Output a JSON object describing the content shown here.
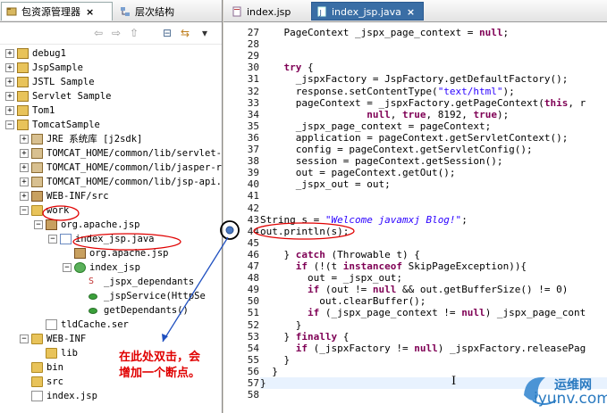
{
  "left_tabs": [
    {
      "label": "包资源管理器",
      "close": "×"
    },
    {
      "label": "层次结构"
    }
  ],
  "editor_tabs": [
    {
      "label": "index.jsp"
    },
    {
      "label": "index_jsp.java",
      "close": "×"
    }
  ],
  "tree": [
    {
      "label": "debug1"
    },
    {
      "label": "JspSample"
    },
    {
      "label": "JSTL Sample"
    },
    {
      "label": "Servlet Sample"
    },
    {
      "label": "Tom1"
    },
    {
      "label": "TomcatSample"
    },
    {
      "label": "JRE 系统库 [j2sdk]"
    },
    {
      "label": "TOMCAT_HOME/common/lib/servlet-"
    },
    {
      "label": "TOMCAT_HOME/common/lib/jasper-r"
    },
    {
      "label": "TOMCAT_HOME/common/lib/jsp-api."
    },
    {
      "label": "WEB-INF/src"
    },
    {
      "label": "work"
    },
    {
      "label": "org.apache.jsp"
    },
    {
      "label": "index_jsp.java"
    },
    {
      "label": "org.apache.jsp"
    },
    {
      "label": "index_jsp"
    },
    {
      "label": "_jspx_dependants"
    },
    {
      "label": "_jspService(HttpSe"
    },
    {
      "label": "getDependants()"
    },
    {
      "label": "tldCache.ser"
    },
    {
      "label": "WEB-INF"
    },
    {
      "label": "lib"
    },
    {
      "label": "bin"
    },
    {
      "label": "src"
    },
    {
      "label": "index.jsp"
    }
  ],
  "code_lines": [
    {
      "n": "27",
      "segs": [
        {
          "t": "    PageContext _jspx_page_context = "
        },
        {
          "t": "null",
          "c": "kw"
        },
        {
          "t": ";"
        }
      ]
    },
    {
      "n": "28",
      "segs": [
        {
          "t": ""
        }
      ]
    },
    {
      "n": "29",
      "segs": [
        {
          "t": ""
        }
      ]
    },
    {
      "n": "30",
      "segs": [
        {
          "t": "    "
        },
        {
          "t": "try",
          "c": "kw"
        },
        {
          "t": " {"
        }
      ]
    },
    {
      "n": "31",
      "segs": [
        {
          "t": "      _jspxFactory = JspFactory.getDefaultFactory();"
        }
      ]
    },
    {
      "n": "32",
      "segs": [
        {
          "t": "      response.setContentType("
        },
        {
          "t": "\"text/html\"",
          "c": "str"
        },
        {
          "t": ");"
        }
      ]
    },
    {
      "n": "33",
      "segs": [
        {
          "t": "      pageContext = _jspxFactory.getPageContext("
        },
        {
          "t": "this",
          "c": "kw"
        },
        {
          "t": ", r"
        }
      ]
    },
    {
      "n": "34",
      "segs": [
        {
          "t": "                  "
        },
        {
          "t": "null",
          "c": "kw"
        },
        {
          "t": ", "
        },
        {
          "t": "true",
          "c": "kw"
        },
        {
          "t": ", 8192, "
        },
        {
          "t": "true",
          "c": "kw"
        },
        {
          "t": ");"
        }
      ]
    },
    {
      "n": "35",
      "segs": [
        {
          "t": "      _jspx_page_context = pageContext;"
        }
      ]
    },
    {
      "n": "36",
      "segs": [
        {
          "t": "      application = pageContext.getServletContext();"
        }
      ]
    },
    {
      "n": "37",
      "segs": [
        {
          "t": "      config = pageContext.getServletConfig();"
        }
      ]
    },
    {
      "n": "38",
      "segs": [
        {
          "t": "      session = pageContext.getSession();"
        }
      ]
    },
    {
      "n": "39",
      "segs": [
        {
          "t": "      out = pageContext.getOut();"
        }
      ]
    },
    {
      "n": "40",
      "segs": [
        {
          "t": "      _jspx_out = out;"
        }
      ]
    },
    {
      "n": "41",
      "segs": [
        {
          "t": ""
        }
      ]
    },
    {
      "n": "42",
      "segs": [
        {
          "t": ""
        }
      ]
    },
    {
      "n": "43",
      "segs": [
        {
          "t": "String s = "
        },
        {
          "t": "\"Welcome javamxj Blog!\"",
          "c": "ital"
        },
        {
          "t": ";"
        }
      ]
    },
    {
      "n": "44",
      "segs": [
        {
          "t": "out.println(s);"
        }
      ]
    },
    {
      "n": "45",
      "segs": [
        {
          "t": ""
        }
      ]
    },
    {
      "n": "46",
      "segs": [
        {
          "t": "    } "
        },
        {
          "t": "catch",
          "c": "kw"
        },
        {
          "t": " (Throwable t) {"
        }
      ]
    },
    {
      "n": "47",
      "segs": [
        {
          "t": "      "
        },
        {
          "t": "if",
          "c": "kw"
        },
        {
          "t": " (!(t "
        },
        {
          "t": "instanceof",
          "c": "kw"
        },
        {
          "t": " SkipPageException)){"
        }
      ]
    },
    {
      "n": "48",
      "segs": [
        {
          "t": "        out = _jspx_out;"
        }
      ]
    },
    {
      "n": "49",
      "segs": [
        {
          "t": "        "
        },
        {
          "t": "if",
          "c": "kw"
        },
        {
          "t": " (out != "
        },
        {
          "t": "null",
          "c": "kw"
        },
        {
          "t": " && out.getBufferSize() != 0)"
        }
      ]
    },
    {
      "n": "50",
      "segs": [
        {
          "t": "          out.clearBuffer();"
        }
      ]
    },
    {
      "n": "51",
      "segs": [
        {
          "t": "        "
        },
        {
          "t": "if",
          "c": "kw"
        },
        {
          "t": " (_jspx_page_context != "
        },
        {
          "t": "null",
          "c": "kw"
        },
        {
          "t": ") _jspx_page_cont"
        }
      ]
    },
    {
      "n": "52",
      "segs": [
        {
          "t": "      }"
        }
      ]
    },
    {
      "n": "53",
      "segs": [
        {
          "t": "    } "
        },
        {
          "t": "finally",
          "c": "kw"
        },
        {
          "t": " {"
        }
      ]
    },
    {
      "n": "54",
      "segs": [
        {
          "t": "      "
        },
        {
          "t": "if",
          "c": "kw"
        },
        {
          "t": " (_jspxFactory != "
        },
        {
          "t": "null",
          "c": "kw"
        },
        {
          "t": ") _jspxFactory.releasePag"
        }
      ]
    },
    {
      "n": "55",
      "segs": [
        {
          "t": "    }"
        }
      ]
    },
    {
      "n": "56",
      "segs": [
        {
          "t": "  }"
        }
      ]
    },
    {
      "n": "57",
      "segs": [
        {
          "t": "}"
        }
      ]
    },
    {
      "n": "58",
      "segs": [
        {
          "t": ""
        }
      ]
    }
  ],
  "annotation": {
    "line1": "在此处双击，会",
    "line2": "增加一个断点。"
  },
  "watermark": {
    "cn": "运维网",
    "en": "iyunv.com"
  },
  "colors": {
    "annotation_red": "#e00000",
    "keyword": "#7f0055",
    "string": "#2a00ff",
    "watermark_blue": "#2a7ac0"
  }
}
